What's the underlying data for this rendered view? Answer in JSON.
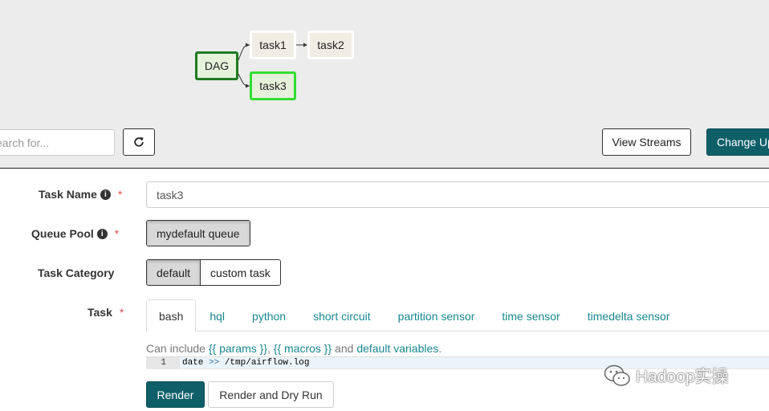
{
  "graph": {
    "nodes": {
      "dag": "DAG",
      "task1": "task1",
      "task2": "task2",
      "task3": "task3"
    }
  },
  "toolbar": {
    "search_placeholder": "earch for...",
    "refresh_icon": "refresh-icon",
    "view_streams_label": "View Streams",
    "change_label": "Change Up"
  },
  "form": {
    "task_name": {
      "label": "Task Name",
      "required_mark": "*",
      "value": "task3"
    },
    "queue_pool": {
      "label": "Queue Pool",
      "required_mark": "*",
      "option": "mydefault queue"
    },
    "task_category": {
      "label": "Task Category",
      "options": [
        "default",
        "custom task"
      ],
      "selected": "default"
    },
    "task": {
      "label": "Task",
      "required_mark": "*",
      "tabs": [
        "bash",
        "hql",
        "python",
        "short circuit",
        "partition sensor",
        "time sensor",
        "timedelta sensor"
      ],
      "active_tab": "bash",
      "help": {
        "prefix": "Can include ",
        "params_link": "{{ params }}",
        "sep": ", ",
        "macros_link": "{{ macros }}",
        "mid": " and ",
        "vars_link": "default variables",
        "suffix": "."
      },
      "editor": {
        "line_number": "1",
        "code_cmd": "date ",
        "code_op": ">>",
        "code_path": " /tmp/airflow.log"
      }
    },
    "buttons": {
      "render": "Render",
      "dry_run": "Render and Dry Run"
    }
  },
  "watermark": {
    "text": "Hadoop实操"
  },
  "colors": {
    "primary": "#0f5f69",
    "link": "#17878f",
    "required": "#d9534f",
    "dag_border": "#1f7a1f",
    "selected_node_border": "#33dd33"
  }
}
